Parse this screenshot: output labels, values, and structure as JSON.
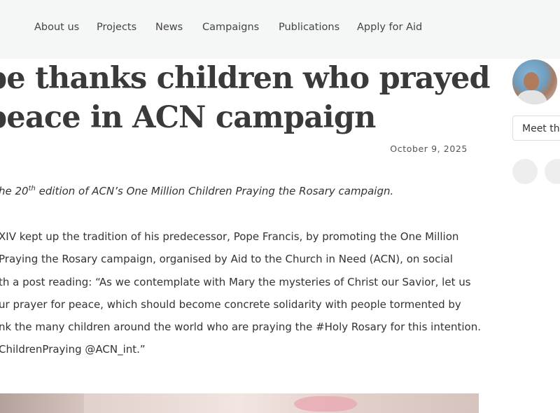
{
  "nav": {
    "items": [
      {
        "label": "About us"
      },
      {
        "label": "Projects"
      },
      {
        "label": "News"
      },
      {
        "label": "Campaigns"
      },
      {
        "label": "Publications"
      },
      {
        "label": "Apply for Aid"
      }
    ]
  },
  "article": {
    "title_lines": [
      "pe thanks children who prayed",
      "peace in ACN campaign"
    ],
    "date": "October 9, 2025",
    "lead_pre": "he 20",
    "lead_sup": "th",
    "lead_post": " edition of ACN’s One Million Children Praying the Rosary campaign.",
    "body_lines": [
      "XIV kept up the tradition of his predecessor, Pope Francis, by promoting the One Million",
      "Praying the Rosary campaign, organised by Aid to the Church in Need (ACN), on social",
      "th a post reading: “As we contemplate with Mary the mysteries of Christ our Savior, let us",
      "ur prayer for peace, which should become concrete solidarity with people tormented by",
      "nk the many children around the world who are praying the #Holy Rosary for this intention.",
      "ChildrenPraying @ACN_int.”"
    ]
  },
  "sidebar": {
    "meet_button_label": "Meet the"
  },
  "colors": {
    "nav_background": "#f5f6f6",
    "title_color": "#3a3a3a",
    "circle_button": "#eeeeee"
  }
}
